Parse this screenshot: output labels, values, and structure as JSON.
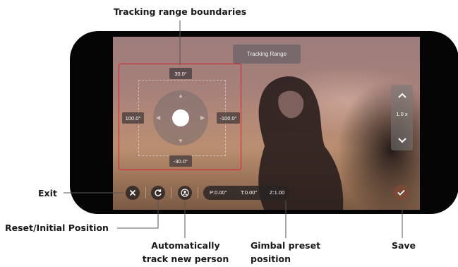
{
  "annotations": {
    "tracking_range_boundaries": "Tracking range boundaries",
    "exit": "Exit",
    "reset_initial_position": "Reset/Initial Position",
    "auto_track_line1": "Automatically",
    "auto_track_line2": "track new person",
    "gimbal_preset_line1": "Gimbal preset",
    "gimbal_preset_line2": "position",
    "save": "Save"
  },
  "screen": {
    "tracking_range_label": "Tracking Range",
    "bounds": {
      "top": "30.0°",
      "bottom": "-30.0°",
      "left": "100.0°",
      "right": "-100.0°"
    },
    "zoom": {
      "value": "1.0 x",
      "up_icon": "chevron-up-icon",
      "down_icon": "chevron-down-icon"
    },
    "toolbar": {
      "exit_icon": "close-icon",
      "reset_icon": "rotate-reset-icon",
      "auto_track_icon": "person-track-icon",
      "pan": "P:0.00°",
      "tilt": "T:0.00°",
      "zoom": "Z:1.00",
      "save_icon": "check-icon"
    }
  },
  "colors": {
    "boundary": "#e0192a",
    "save_button": "#7a4a36"
  }
}
